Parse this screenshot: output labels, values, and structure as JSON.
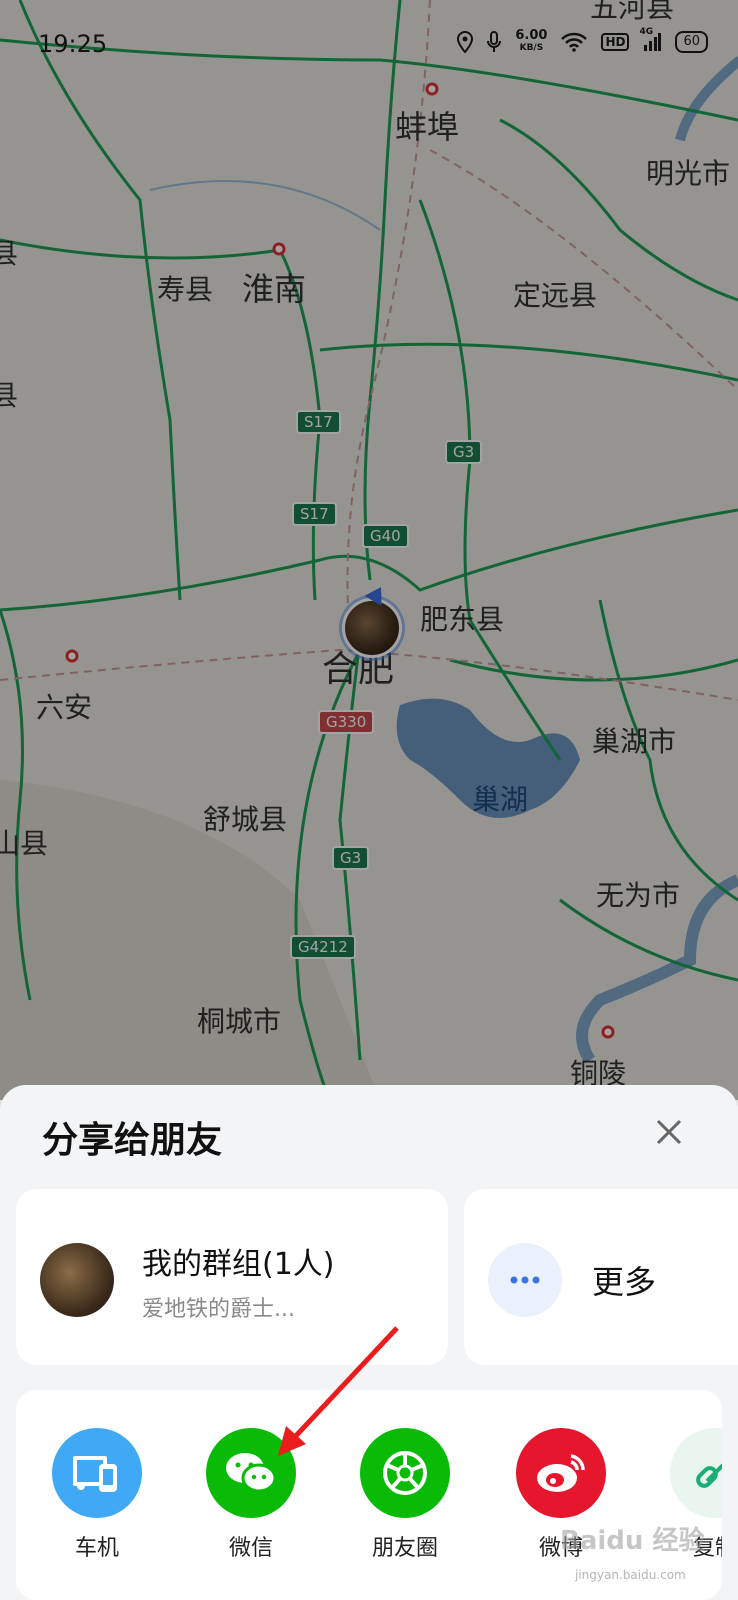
{
  "status": {
    "time": "19:25",
    "net_speed": "6.00",
    "net_unit": "KB/S",
    "hd": "HD",
    "signal": "4G",
    "battery": "60"
  },
  "map": {
    "cities": [
      "五河县",
      "蚌埠",
      "明光市",
      "寿县",
      "淮南",
      "定远县",
      "肥东县",
      "合肥",
      "六安",
      "巢湖市",
      "巢湖",
      "舒城县",
      "无为市",
      "桐城市",
      "铜陵",
      "山县",
      "县",
      "县"
    ],
    "road_shields": [
      "S17",
      "S17",
      "G3",
      "G40",
      "G330",
      "G3",
      "G4212"
    ]
  },
  "share": {
    "title": "分享给朋友",
    "group": {
      "name": "我的群组(1人)",
      "subtitle": "爱地铁的爵士..."
    },
    "more": {
      "label": "更多"
    },
    "apps": [
      {
        "label": "车机",
        "icon": "car-screen-icon",
        "color": "#3fa9f5"
      },
      {
        "label": "微信",
        "icon": "wechat-icon",
        "color": "#09bb07"
      },
      {
        "label": "朋友圈",
        "icon": "moments-icon",
        "color": "#09bb07"
      },
      {
        "label": "微博",
        "icon": "weibo-icon",
        "color": "#e6162d"
      },
      {
        "label": "复制",
        "icon": "copy-link-icon",
        "color": "#1aad75"
      }
    ]
  },
  "watermark": {
    "text": "Baidu 经验",
    "url": "jingyan.baidu.com"
  }
}
